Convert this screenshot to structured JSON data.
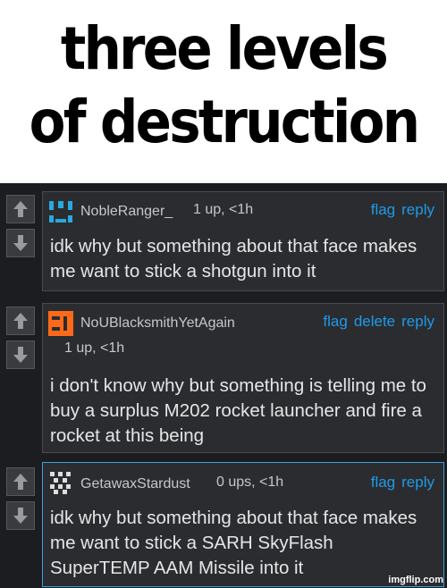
{
  "caption": {
    "line1": "three levels",
    "line2": "of destruction"
  },
  "comments": [
    {
      "username": "NobleRanger_",
      "meta": "1 up, <1h",
      "actions": [
        "flag",
        "reply"
      ],
      "text": "idk why but something about that face makes me want to stick a shotgun into it",
      "avatar_color": "#29a8e0",
      "selected": false
    },
    {
      "username": "NoUBlacksmithYetAgain",
      "meta": "1 up, <1h",
      "actions": [
        "flag",
        "delete",
        "reply"
      ],
      "text": "i don't know why but something is telling me to buy a surplus M202 rocket launcher and fire a rocket at this being",
      "avatar_color": "#ff6a1a",
      "selected": false
    },
    {
      "username": "GetawaxStardust",
      "meta": "0 ups, <1h",
      "actions": [
        "flag",
        "reply"
      ],
      "text": "idk why but something about that face makes me want to stick a SARH SkyFlash SuperTEMP AAM Missile into it",
      "avatar_color": "#dddddd",
      "selected": true
    }
  ],
  "watermark": "imgflip.com",
  "colors": {
    "link": "#1e9be8",
    "background": "#1c1d20",
    "card": "#2b2c30",
    "selected_border": "#3aa0d8"
  }
}
